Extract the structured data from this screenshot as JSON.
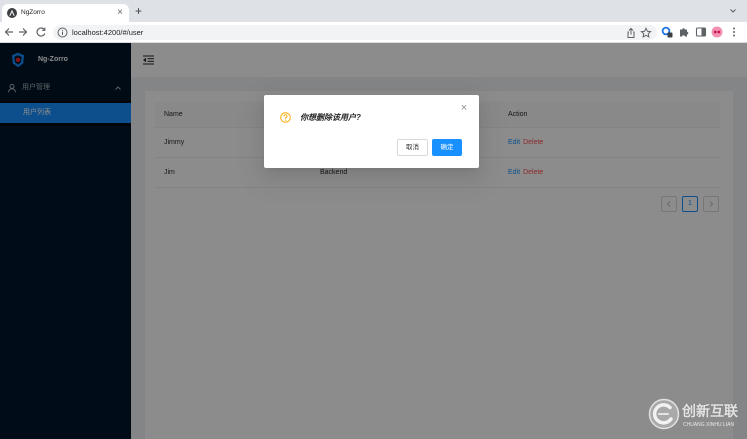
{
  "browser": {
    "tab": {
      "title": "NgZorro",
      "close_glyph": "×"
    },
    "new_tab_glyph": "+",
    "address_bar": {
      "url": "localhost:4200/#/user"
    }
  },
  "sidebar": {
    "brand": "Ng-Zorro",
    "submenu": {
      "label": "用户管理",
      "expanded": true,
      "items": [
        {
          "label": "用户列表",
          "selected": true
        }
      ]
    }
  },
  "table": {
    "headers": {
      "name": "Name",
      "action": "Action"
    },
    "rows": [
      {
        "name": "Jimmy",
        "actions": [
          "Edit",
          "Delete"
        ]
      },
      {
        "name": "Jim",
        "column2": "Backend",
        "actions": [
          "Edit",
          "Delete"
        ]
      }
    ]
  },
  "pagination": {
    "current_page": "1",
    "prev_disabled": true,
    "next_disabled": true
  },
  "modal": {
    "icon": "question-circle-icon",
    "title": "你想删除该用户?",
    "cancel_label": "取消",
    "ok_label": "确定",
    "close_glyph": "×"
  },
  "watermark": {
    "text": "创新互联",
    "subtext": "CHUANG XINHU LIAN"
  },
  "icons": {
    "tab": [
      "angular-favicon-icon",
      "close-icon",
      "chevron-down-icon"
    ],
    "toolbar": [
      "back-arrow-icon",
      "forward-arrow-icon",
      "reload-icon",
      "site-info-icon",
      "share-icon",
      "bookmark-star-icon",
      "extension-icon",
      "extensions-puzzle-icon",
      "side-panel-icon",
      "profile-avatar-icon",
      "more-menu-icon"
    ],
    "sidebar": [
      "ng-zorro-logo-icon",
      "user-icon",
      "chevron-up-icon"
    ],
    "header": [
      "menu-fold-icon"
    ],
    "pagination": [
      "chevron-left-icon",
      "chevron-right-icon"
    ]
  },
  "colors": {
    "primary": "#1890ff",
    "danger": "#ff4d4f",
    "warning": "#faad14",
    "sider_bg": "#001529",
    "submenu_bg": "#000c17",
    "content_bg": "#f0f2f5",
    "tabstrip_bg": "#dee1e6"
  }
}
